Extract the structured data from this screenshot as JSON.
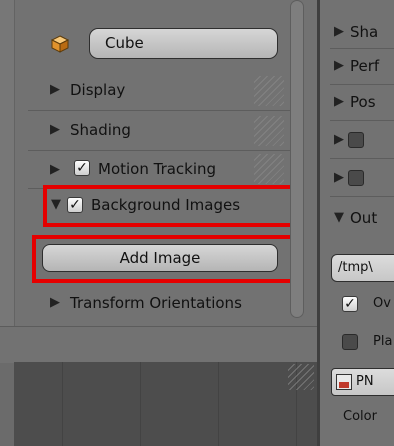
{
  "left": {
    "object_field": "Cube",
    "panels": {
      "display": "Display",
      "shading": "Shading",
      "motion_tracking": "Motion Tracking",
      "background_images": "Background Images",
      "transform_orientations": "Transform Orientations"
    },
    "add_image_label": "Add Image"
  },
  "right": {
    "items": [
      "Sha",
      "Perf",
      "Pos",
      "Out"
    ],
    "path_value": "/tmp\\",
    "checkbox_labels": [
      "Ov",
      "Pla"
    ],
    "format_label": "PN",
    "color_label": "Color"
  },
  "colors": {
    "highlight_red": "#e60000",
    "panel_gray": "#727272"
  }
}
